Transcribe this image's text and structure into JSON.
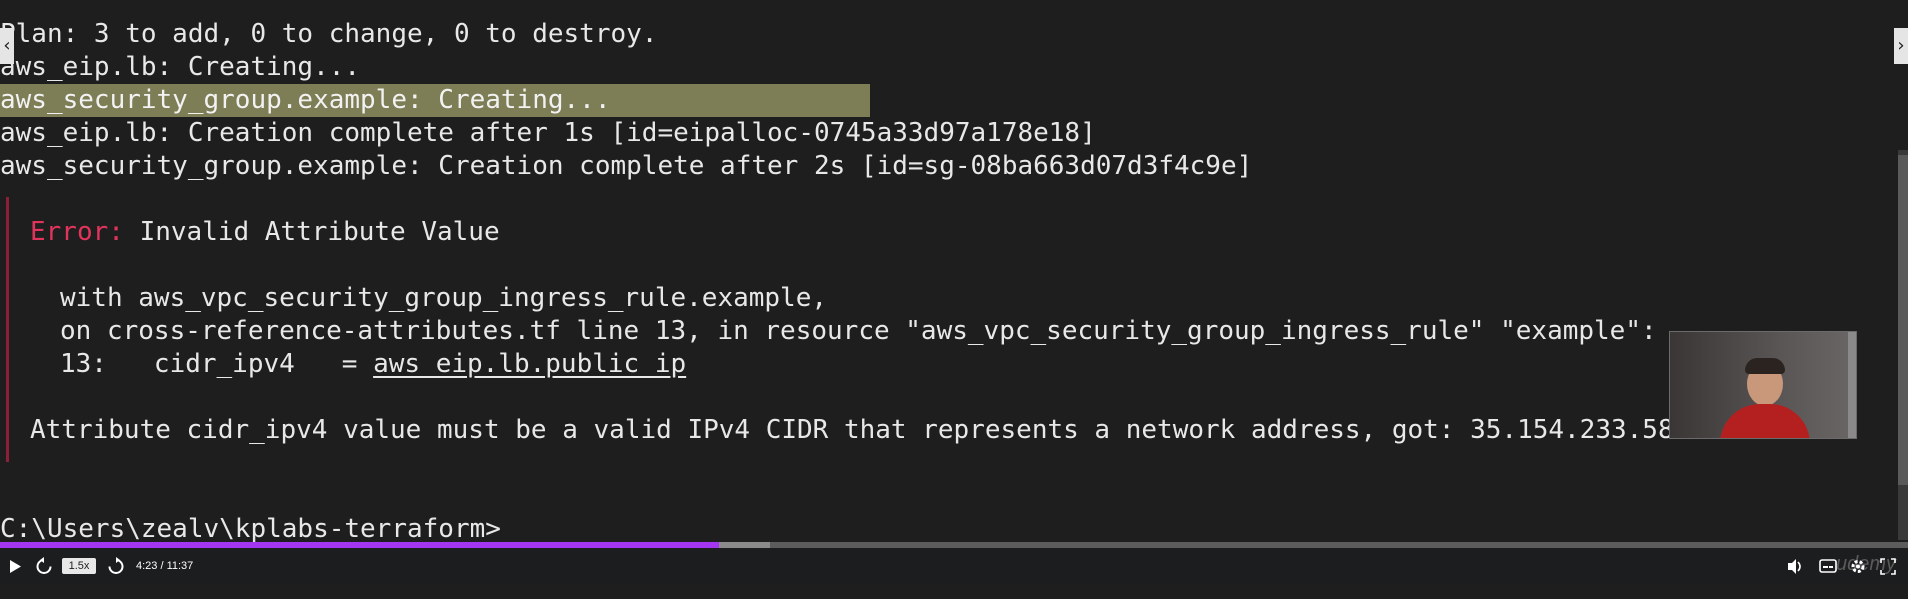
{
  "terminal": {
    "lines": {
      "plan": "Plan: 3 to add, 0 to change, 0 to destroy.",
      "eip_creating": "aws_eip.lb: Creating...",
      "sg_creating": "aws_security_group.example: Creating...",
      "eip_complete": "aws_eip.lb: Creation complete after 1s [id=eipalloc-0745a33d97a178e18]",
      "sg_complete": "aws_security_group.example: Creation complete after 2s [id=sg-08ba663d07d3f4c9e]"
    },
    "error": {
      "label": "Error:",
      "title": " Invalid Attribute Value",
      "with_line": "with aws_vpc_security_group_ingress_rule.example,",
      "on_line": "on cross-reference-attributes.tf line 13, in resource \"aws_vpc_security_group_ingress_rule\" \"example\":",
      "code_prefix": "13:   cidr_ipv4   = ",
      "code_ref": "aws_eip.lb.public_ip",
      "message": "Attribute cidr_ipv4 value must be a valid IPv4 CIDR that represents a network address, got: 35.154.233.58"
    },
    "prompt": "C:\\Users\\zealv\\kplabs-terraform>"
  },
  "player": {
    "play_icon": "play-icon",
    "rewind_icon": "rewind-icon",
    "speed": "1.5x",
    "forward_icon": "forward-icon",
    "time": "4:23 / 11:37",
    "progress_fraction": 0.377,
    "volume_icon": "volume-icon",
    "captions_icon": "captions-icon",
    "settings_icon": "gear-icon",
    "fullscreen_icon": "expand-icon",
    "watermark": "udemy",
    "accent": "#a435f0"
  },
  "nav": {
    "prev_glyph": "‹",
    "next_glyph": "›"
  },
  "colors": {
    "error": "#e0345d",
    "highlight": "#7d7d56",
    "background": "#1e1e1e"
  }
}
